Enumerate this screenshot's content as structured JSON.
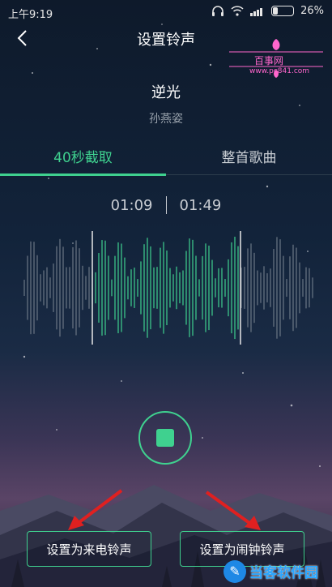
{
  "status_bar": {
    "time": "上午9:19",
    "battery": "26%",
    "battery_level": 0.26
  },
  "header": {
    "title": "设置铃声"
  },
  "watermark_top": {
    "text": "百事网",
    "url": "www.pc841.com"
  },
  "song": {
    "title": "逆光",
    "artist": "孙燕姿"
  },
  "tabs": [
    {
      "label": "40秒截取",
      "active": true
    },
    {
      "label": "整首歌曲",
      "active": false
    }
  ],
  "clip": {
    "start": "01:09",
    "end": "01:49"
  },
  "actions": {
    "set_ringtone": "设置为来电铃声",
    "set_alarm": "设置为闹钟铃声"
  },
  "watermark_bottom": {
    "name": "当客软件园"
  },
  "colors": {
    "accent": "#3fd18f",
    "arrow": "#e02020"
  }
}
